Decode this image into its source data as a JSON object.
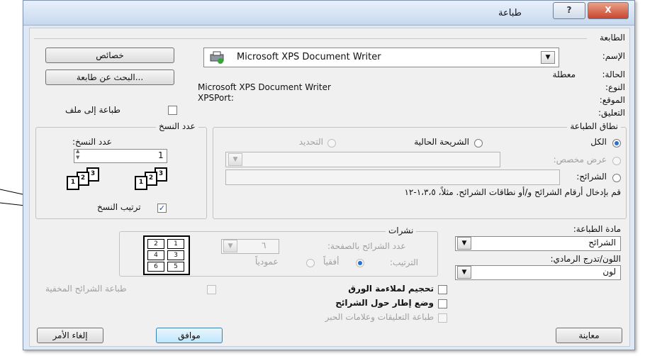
{
  "window": {
    "title": "طباعة",
    "help": "?",
    "close": "X"
  },
  "printer": {
    "group_label": "الطابعة",
    "name_label": "الإسم:",
    "name_value": "Microsoft XPS Document Writer",
    "status_label": "الحالة:",
    "status_value": "معطلة",
    "type_label": "النوع:",
    "type_value": "Microsoft XPS Document Writer",
    "where_label": "الموقع:",
    "where_value": "XPSPort:",
    "comment_label": "التعليق:",
    "properties_button": "خصائص",
    "find_button": "البحث عن طابعة...",
    "print_to_file": "طباعة إلى ملف"
  },
  "range": {
    "group_label": "نطاق الطباعة",
    "all": "الكل",
    "current_slide": "الشريحة الحالية",
    "selection": "التحديد",
    "custom_show": "عرض مخصص:",
    "slides": "الشرائح:",
    "hint": "قم بإدخال أرقام الشرائح و/أو نطاقات الشرائح. مثلاً، ١،٣،٥-١٢"
  },
  "copies": {
    "group_label": "عدد النسخ",
    "count_label": "عدد النسخ:",
    "count_value": "1",
    "collate": "ترتيب النسخ",
    "stack_a": [
      "3",
      "2",
      "1"
    ],
    "stack_b": [
      "3",
      "2",
      "1"
    ]
  },
  "print_what": {
    "label": "مادة الطباعة:",
    "value": "الشرائح"
  },
  "color": {
    "label": "اللون/تدرج الرمادي:",
    "value": "لون"
  },
  "handouts": {
    "group_label": "نشرات",
    "per_page_label": "عدد الشرائح بالصفحة:",
    "per_page_value": "٦",
    "order_label": "الترتيب:",
    "horizontal": "أفقياً",
    "vertical": "عمودياً",
    "preview_cells": [
      "2",
      "1",
      "4",
      "3",
      "6",
      "5"
    ]
  },
  "options": {
    "scale_to_fit": "تحجيم لملاءمة الورق",
    "frame_slides": "وضع إطار حول الشرائح",
    "print_comments": "طباعة التعليقات وعلامات الحبر",
    "print_hidden": "طباعة الشرائح المخفية"
  },
  "buttons": {
    "preview": "معاينة",
    "ok": "موافق",
    "cancel": "إلغاء الأمر"
  },
  "icons": {
    "printer": "printer-icon",
    "dropdown": "▼",
    "spin_up": "▲",
    "spin_down": "▼"
  }
}
